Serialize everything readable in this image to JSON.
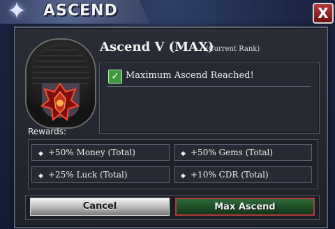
{
  "window": {
    "title": "ASCEND",
    "close_label": "X"
  },
  "rank": {
    "title": "Ascend V (MAX)",
    "subtitle": "(Current Rank)"
  },
  "status": {
    "message": "Maximum Ascend Reached!",
    "checked": true
  },
  "rewards": {
    "label": "Rewards:",
    "items": [
      {
        "text": "+50% Money (Total)"
      },
      {
        "text": "+50% Gems (Total)"
      },
      {
        "text": "+25% Luck (Total)"
      },
      {
        "text": "+10% CDR (Total)"
      }
    ]
  },
  "buttons": {
    "cancel_label": "Cancel",
    "max_ascend_label": "Max Ascend"
  },
  "colors": {
    "accent_red": "#b23a3a",
    "confirm_green": "#2f6a3a",
    "panel_bg": "#262a33"
  }
}
